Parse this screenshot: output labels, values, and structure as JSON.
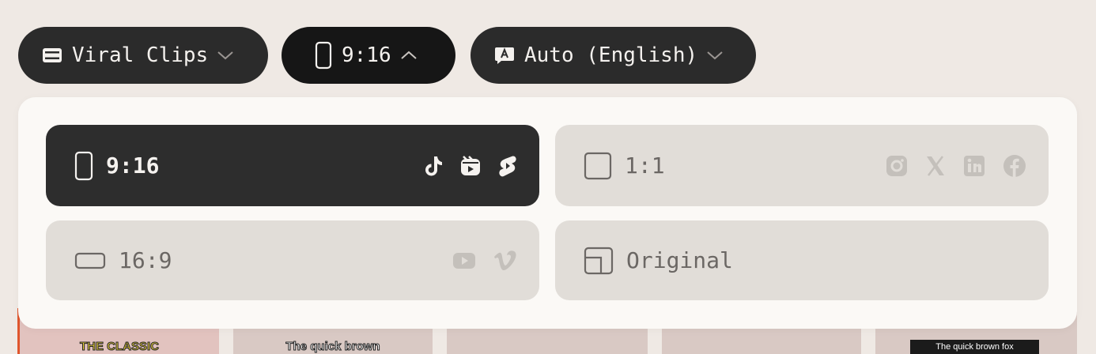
{
  "toolbar": {
    "preset": {
      "label": "Viral Clips",
      "icon": "film-icon"
    },
    "ratio": {
      "label": "9:16",
      "icon": "phone-portrait-icon"
    },
    "language": {
      "label": "Auto (English)",
      "icon": "caption-a-icon"
    }
  },
  "ratio_menu": {
    "selected": "9:16",
    "options": [
      {
        "label": "9:16",
        "icon": "portrait-rect-icon",
        "platforms": [
          "tiktok-icon",
          "instagram-reels-icon",
          "youtube-shorts-icon"
        ]
      },
      {
        "label": "1:1",
        "icon": "square-icon",
        "platforms": [
          "instagram-icon",
          "x-icon",
          "linkedin-icon",
          "facebook-icon"
        ]
      },
      {
        "label": "16:9",
        "icon": "landscape-rect-icon",
        "platforms": [
          "youtube-icon",
          "vimeo-icon"
        ]
      },
      {
        "label": "Original",
        "icon": "original-layout-icon",
        "platforms": []
      }
    ]
  },
  "thumbnails": [
    {
      "caption": "THE CLASSIC"
    },
    {
      "caption": "The quick brown"
    },
    {
      "caption": ""
    },
    {
      "caption": ""
    },
    {
      "caption": "The quick brown fox"
    }
  ],
  "colors": {
    "page_bg": "#efe9e4",
    "pill_bg": "#2b2b2b",
    "panel_bg": "#fbf9f6",
    "selected_bg": "#2d2d2d",
    "option_bg": "#e1ddd8"
  }
}
